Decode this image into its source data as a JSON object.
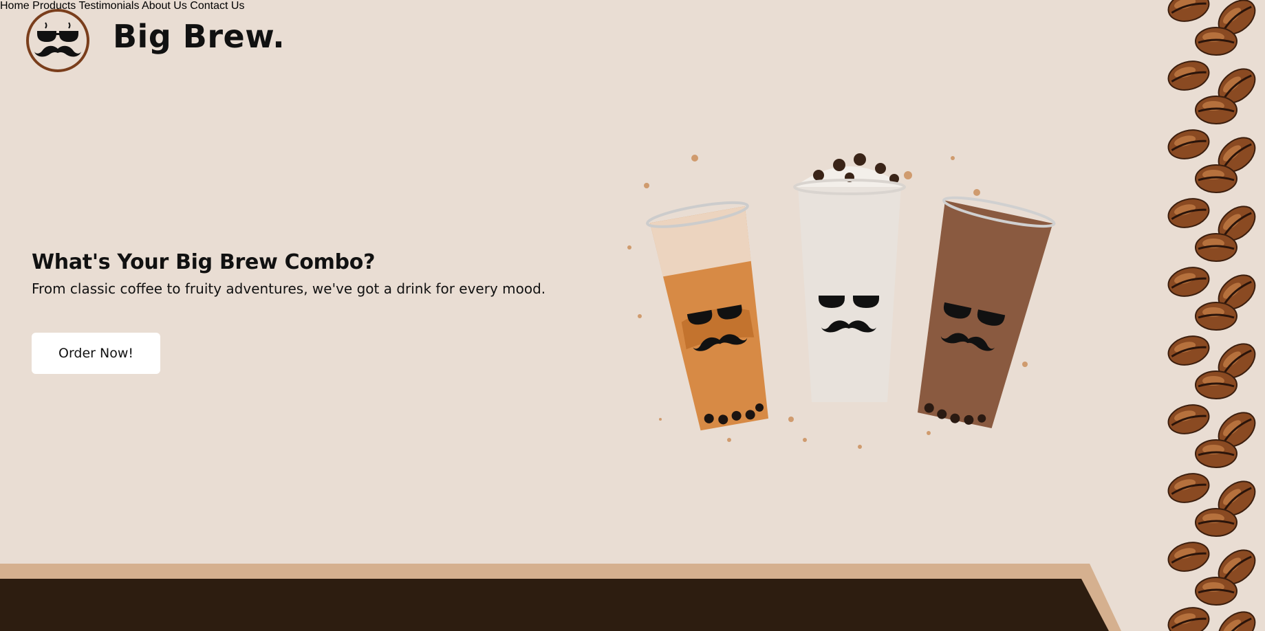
{
  "brand": {
    "name": "Big Brew."
  },
  "nav": {
    "items": [
      {
        "label": "Home"
      },
      {
        "label": "Products"
      },
      {
        "label": "Testimonials"
      },
      {
        "label": "About Us"
      },
      {
        "label": "Contact Us"
      }
    ]
  },
  "hero": {
    "title": "What's Your Big Brew Combo?",
    "subtitle": "From classic coffee to fruity adventures, we've got a drink for every mood.",
    "cta_label": "Order Now!"
  },
  "colors": {
    "background": "#e9ddd3",
    "logo_ring": "#7a3e1c",
    "band_tan": "#d5b08f",
    "band_dark": "#2d1d10",
    "button_bg": "#ffffff"
  }
}
